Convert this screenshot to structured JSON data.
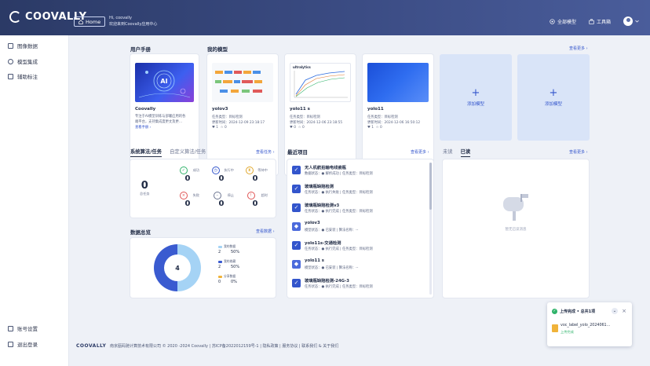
{
  "header": {
    "logo": "COOVALLY",
    "home_label": "Home",
    "greeting": "Hi, coovally",
    "welcome": "欢迎来到Coovally应用中心",
    "models_label": "全部模型",
    "toolbox_label": "工具箱"
  },
  "sidebar": {
    "items": [
      {
        "label": "图像数据"
      },
      {
        "label": "模型集成"
      },
      {
        "label": "辅助标注"
      }
    ],
    "account_label": "账号设置",
    "logout_label": "退出登录"
  },
  "manual": {
    "section_title": "用户手册",
    "card_title": "Coovally",
    "desc_line1": "专注于AI模型训练与部署应用的各",
    "desc_line2": "端平台，支持集成度更丈及更…",
    "link": "查看手册 ›"
  },
  "models": {
    "section_title": "我的模型",
    "more_label": "查看更多 ›",
    "items": [
      {
        "name": "yolov3",
        "task": "任务类型：目标检测",
        "updated": "更新时间：2024-12-09 23:18:17",
        "likes": "1",
        "favs": "0"
      },
      {
        "name": "yolo11 s",
        "task": "任务类型：目标检测",
        "updated": "更新时间：2024-12-06 23:18:55",
        "likes": "0",
        "favs": "0"
      },
      {
        "name": "yolo11",
        "task": "任务类型：目标检测",
        "updated": "更新时间：2024-12-06 16:50:12",
        "likes": "1",
        "favs": "0"
      }
    ],
    "add_label_1": "添加模型",
    "add_label_2": "添加模型"
  },
  "tasks": {
    "tab_system": "系统算法/任务",
    "tab_custom": "自定义算法/任务",
    "more_label": "查看任务 ›",
    "total_num": "0",
    "total_label": "总任务",
    "stats": [
      {
        "label": "成功",
        "num": "0",
        "icon": "check-icon",
        "color": "#2fb36a"
      },
      {
        "label": "执行中",
        "num": "0",
        "icon": "clock-icon",
        "color": "#3355cc"
      },
      {
        "label": "等待中",
        "num": "0",
        "icon": "hourglass-icon",
        "color": "#e0a82e"
      },
      {
        "label": "失败",
        "num": "0",
        "icon": "x-icon",
        "color": "#e05454"
      },
      {
        "label": "停止",
        "num": "0",
        "icon": "stop-icon",
        "color": "#6b7490"
      },
      {
        "label": "超时",
        "num": "0",
        "icon": "timeout-icon",
        "color": "#e05454"
      }
    ]
  },
  "data_overview": {
    "section_title": "数据总览",
    "more_label": "查看数据 ›",
    "center_value": "4",
    "legend": [
      {
        "name": "我的数据",
        "count": "2",
        "percent": "50%",
        "color": "#a5d3f5"
      },
      {
        "name": "我的收藏",
        "count": "2",
        "percent": "50%",
        "color": "#3a5bd0"
      },
      {
        "name": "分享数据",
        "count": "0",
        "percent": "0%",
        "color": "#f0b33a"
      }
    ]
  },
  "projects": {
    "section_title": "最近项目",
    "more_label": "查看更多 ›",
    "items": [
      {
        "name": "无人机航拍输电线瓷瓶",
        "meta": "数据状态：● 解析成功 | 任务类型：目标检测",
        "icon": "check-icon"
      },
      {
        "name": "玻璃瓶缺陷检测",
        "meta": "任务状态：● 执行失败 | 任务类型：目标检测",
        "icon": "check-icon"
      },
      {
        "name": "玻璃瓶缺陷检测v3",
        "meta": "任务状态：● 执行完成 | 任务类型：目标检测",
        "icon": "check-icon"
      },
      {
        "name": "yolov3",
        "meta": "模型状态：● 已安装 | 算法名称：--",
        "icon": "cube-icon"
      },
      {
        "name": "yolo11s-交通检测",
        "meta": "任务状态：● 执行完成 | 任务类型：目标检测",
        "icon": "check-icon"
      },
      {
        "name": "yolo11 s",
        "meta": "模型状态：● 已安装 | 算法名称：--",
        "icon": "cube-icon"
      },
      {
        "name": "玻璃瓶缺陷检测-24G-3",
        "meta": "任务状态：● 执行完成 | 任务类型：目标检测",
        "icon": "check-icon"
      }
    ]
  },
  "messages": {
    "tab_unread": "未读",
    "tab_read": "已读",
    "more_label": "查看更多 ›",
    "empty_text": "暂无已读消息"
  },
  "footer": {
    "brand": "COOVALLY",
    "text": "南京瓯码驰计算技术有限公司 © 2020 -2024 Coovally | 苏ICP备2022012159号-1 | 隐私政策 | 服务协议 | 联系我们 & 关于我们"
  },
  "upload_toast": {
    "title": "上传完成 • 总共1项",
    "file_name": "voc_label_yolo_2024061…",
    "status": "上传完成"
  },
  "colors": {
    "topbar": "#2b3a66",
    "accent": "#3355cc",
    "add_card_bg": "#d9e4f8"
  }
}
